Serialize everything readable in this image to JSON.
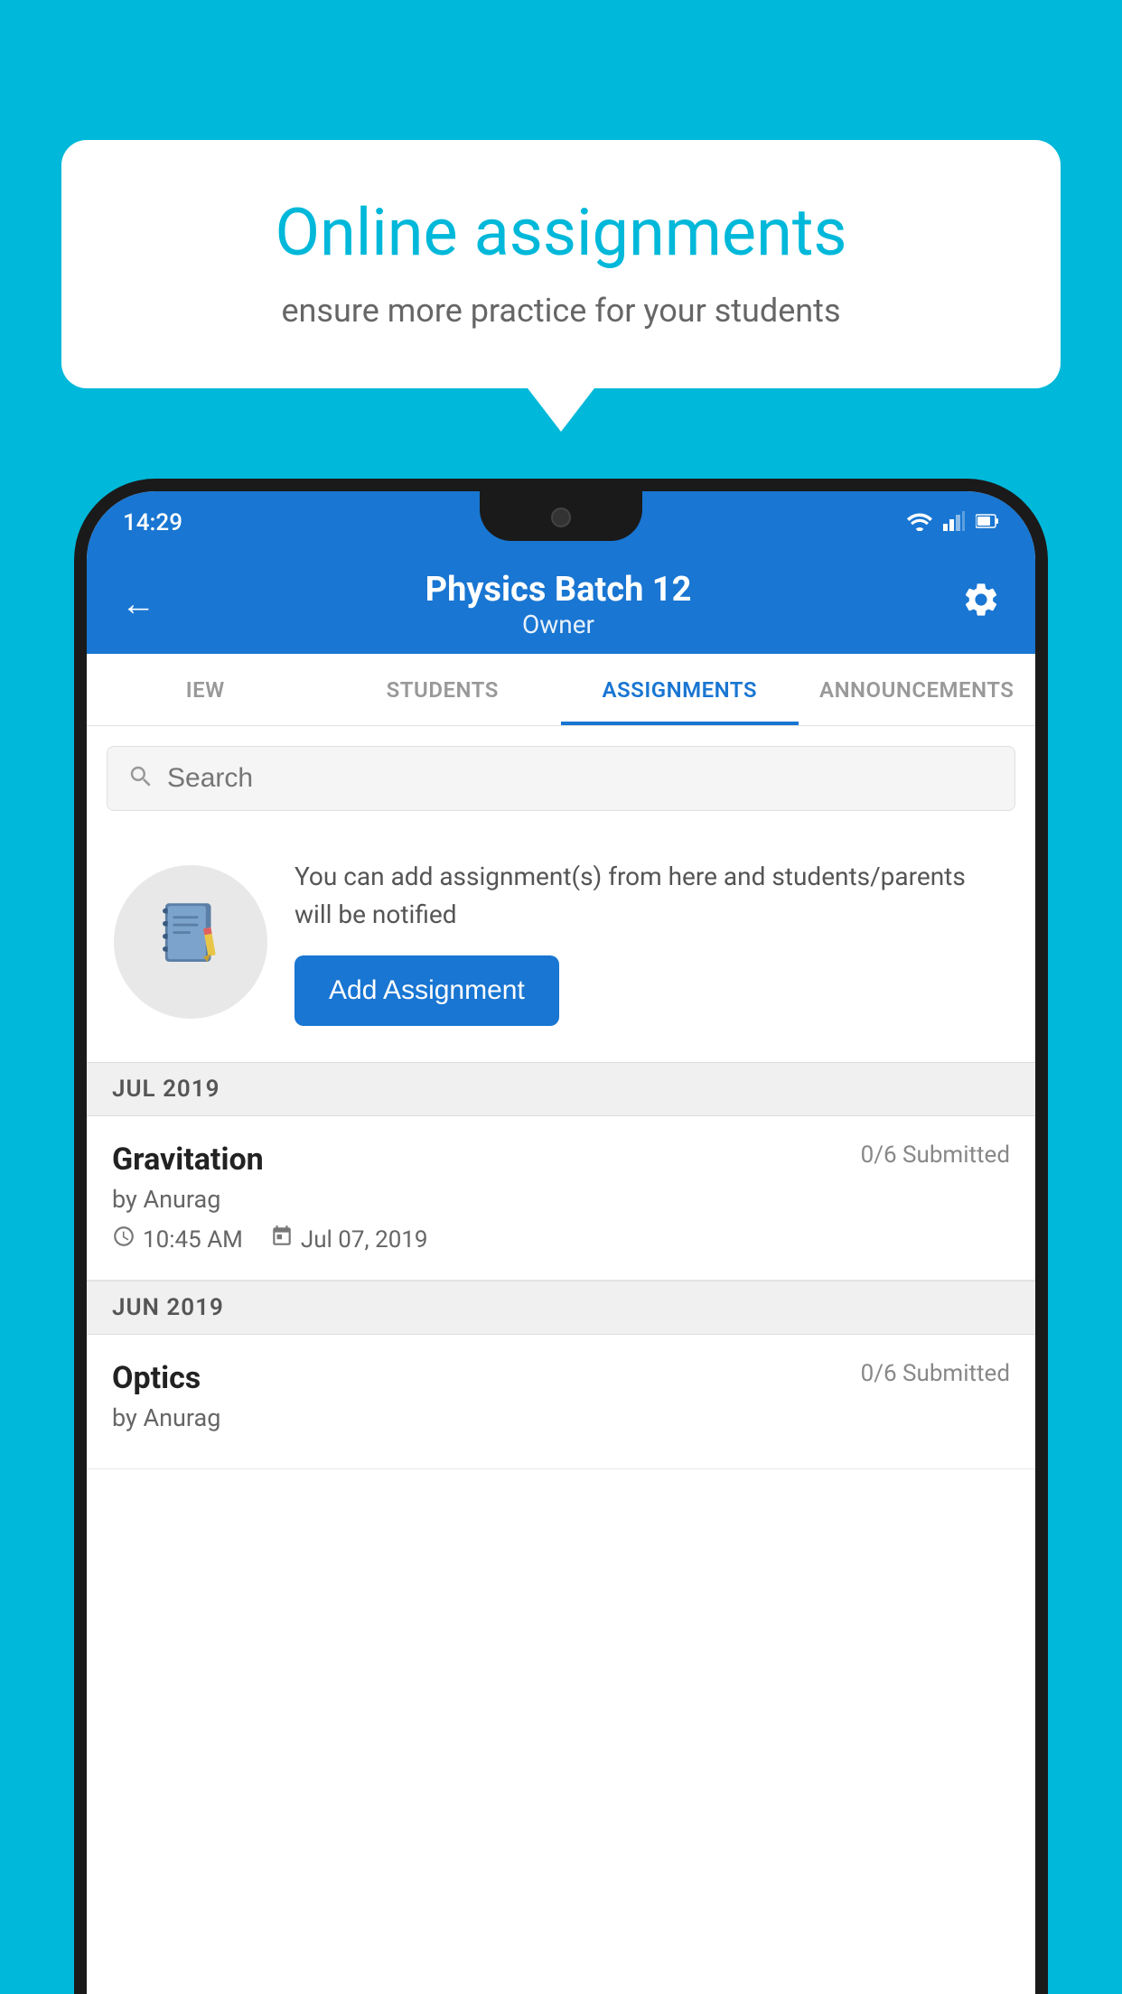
{
  "background_color": "#00B8D9",
  "speech_bubble": {
    "title": "Online assignments",
    "subtitle": "ensure more practice for your students"
  },
  "status_bar": {
    "time": "14:29",
    "wifi": "▼",
    "signal": "▲",
    "battery": "▮"
  },
  "app_bar": {
    "title": "Physics Batch 12",
    "subtitle": "Owner",
    "back_label": "←",
    "settings_label": "⚙"
  },
  "tabs": [
    {
      "label": "IEW",
      "active": false
    },
    {
      "label": "STUDENTS",
      "active": false
    },
    {
      "label": "ASSIGNMENTS",
      "active": true
    },
    {
      "label": "ANNOUNCEMENTS",
      "active": false
    }
  ],
  "search": {
    "placeholder": "Search"
  },
  "promo": {
    "description": "You can add assignment(s) from here and students/parents will be notified",
    "button_label": "Add Assignment"
  },
  "assignment_sections": [
    {
      "month": "JUL 2019",
      "assignments": [
        {
          "title": "Gravitation",
          "submitted": "0/6 Submitted",
          "author": "by Anurag",
          "time": "10:45 AM",
          "date": "Jul 07, 2019"
        }
      ]
    },
    {
      "month": "JUN 2019",
      "assignments": [
        {
          "title": "Optics",
          "submitted": "0/6 Submitted",
          "author": "by Anurag",
          "time": "",
          "date": ""
        }
      ]
    }
  ]
}
